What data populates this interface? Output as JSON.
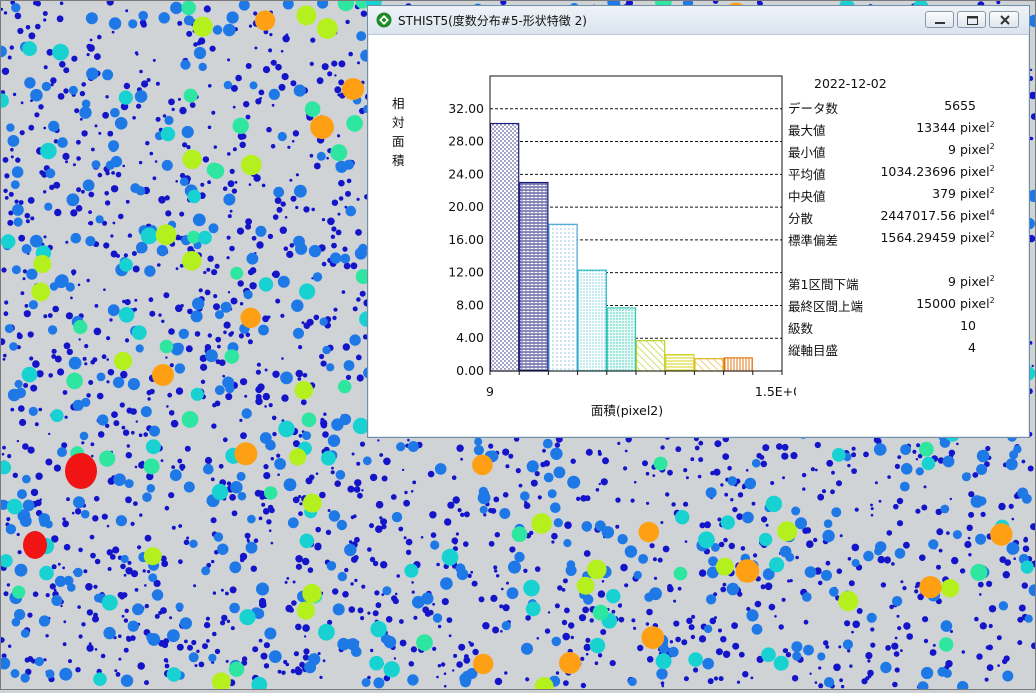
{
  "window": {
    "title": "STHIST5(度数分布#5-形状特徴 2)",
    "icon": "app-diamond-icon"
  },
  "chart_data": {
    "type": "bar",
    "title": "",
    "xlabel": "面積(pixel2)",
    "ylabel": "相対面積",
    "ylim": [
      0,
      36
    ],
    "yticks": [
      "0.00",
      "4.00",
      "8.00",
      "12.00",
      "16.00",
      "20.00",
      "24.00",
      "28.00",
      "32.00"
    ],
    "xticks": [
      "9",
      "1.5E+04"
    ],
    "x_range": [
      9,
      15000
    ],
    "bins": 10,
    "values": [
      30.2,
      23.0,
      17.9,
      12.3,
      7.7,
      3.7,
      2.0,
      1.5,
      1.6,
      0
    ],
    "grid": true,
    "bar_colors": [
      "#1a1a7a",
      "#1a1a7a",
      "#4aa3d6",
      "#2bb8c8",
      "#3cc6b0",
      "#b6d22a",
      "#d8d020",
      "#e6b020",
      "#e07818",
      "#d04010"
    ]
  },
  "stats": {
    "date": "2022-12-02",
    "rows": [
      {
        "label": "データ数",
        "value": "5655",
        "unit": ""
      },
      {
        "label": "最大値",
        "value": "13344",
        "unit": "pixel",
        "sup": "2"
      },
      {
        "label": "最小値",
        "value": "9",
        "unit": "pixel",
        "sup": "2"
      },
      {
        "label": "平均値",
        "value": "1034.23696",
        "unit": "pixel",
        "sup": "2"
      },
      {
        "label": "中央値",
        "value": "379",
        "unit": "pixel",
        "sup": "2"
      },
      {
        "label": "分散",
        "value": "2447017.56",
        "unit": "pixel",
        "sup": "4"
      },
      {
        "label": "標準偏差",
        "value": "1564.29459",
        "unit": "pixel",
        "sup": "2"
      },
      {
        "label": "第1区間下端",
        "value": "9",
        "unit": "pixel",
        "sup": "2"
      },
      {
        "label": "最終区間上端",
        "value": "15000",
        "unit": "pixel",
        "sup": "2"
      },
      {
        "label": "級数",
        "value": "10",
        "unit": ""
      },
      {
        "label": "縦軸目盛",
        "value": "4",
        "unit": ""
      }
    ]
  },
  "colors": {
    "dot_small": "#1414c8",
    "dot_mid": "#1e78e6",
    "dot_cyan": "#18d2d2",
    "dot_green": "#2ee6a0",
    "dot_yellow": "#b4f01e",
    "dot_orange": "#ffa014",
    "dot_red": "#f01414"
  }
}
